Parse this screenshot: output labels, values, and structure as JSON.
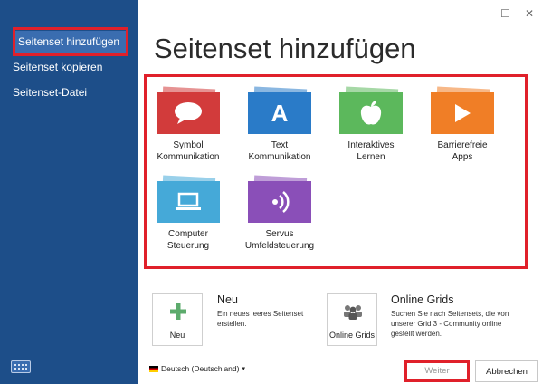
{
  "window": {
    "maximize_glyph": "☐",
    "close_glyph": "✕"
  },
  "sidebar": {
    "items": [
      {
        "label": "Seitenset hinzufügen"
      },
      {
        "label": "Seitenset kopieren"
      },
      {
        "label": "Seitenset-Datei"
      }
    ]
  },
  "main": {
    "title": "Seitenset hinzufügen"
  },
  "tiles": [
    {
      "line1": "Symbol",
      "line2": "Kommunikation",
      "color": "#d23b3b",
      "icon": "speech-bubble-icon"
    },
    {
      "line1": "Text",
      "line2": "Kommunikation",
      "color": "#2a7bc8",
      "icon": "letter-a-icon",
      "glyph": "A"
    },
    {
      "line1": "Interaktives Lernen",
      "line2": "",
      "color": "#5cb85c",
      "icon": "apple-icon"
    },
    {
      "line1": "Barrierefreie Apps",
      "line2": "",
      "color": "#f07e26",
      "icon": "play-icon"
    },
    {
      "line1": "Computer",
      "line2": "Steuerung",
      "color": "#45a9d8",
      "icon": "laptop-icon"
    },
    {
      "line1": "Servus",
      "line2": "Umfeldsteuerung",
      "color": "#8a4fb8",
      "icon": "wireless-signal-icon"
    }
  ],
  "new_card": {
    "title": "Neu",
    "description_line1": "Ein neues leeres Seitenset",
    "description_line2": "erstellen.",
    "box_label": "Neu",
    "plus_color": "#5cab6c"
  },
  "online_card": {
    "title": "Online Grids",
    "description_line1": "Suchen Sie nach Seitensets, die von",
    "description_line2": "unserer Grid 3 - Community online",
    "description_line3": "gestellt werden.",
    "box_label": "Online Grids"
  },
  "footer": {
    "language": "Deutsch (Deutschland)",
    "weiter": "Weiter",
    "abbrechen": "Abbrechen"
  }
}
